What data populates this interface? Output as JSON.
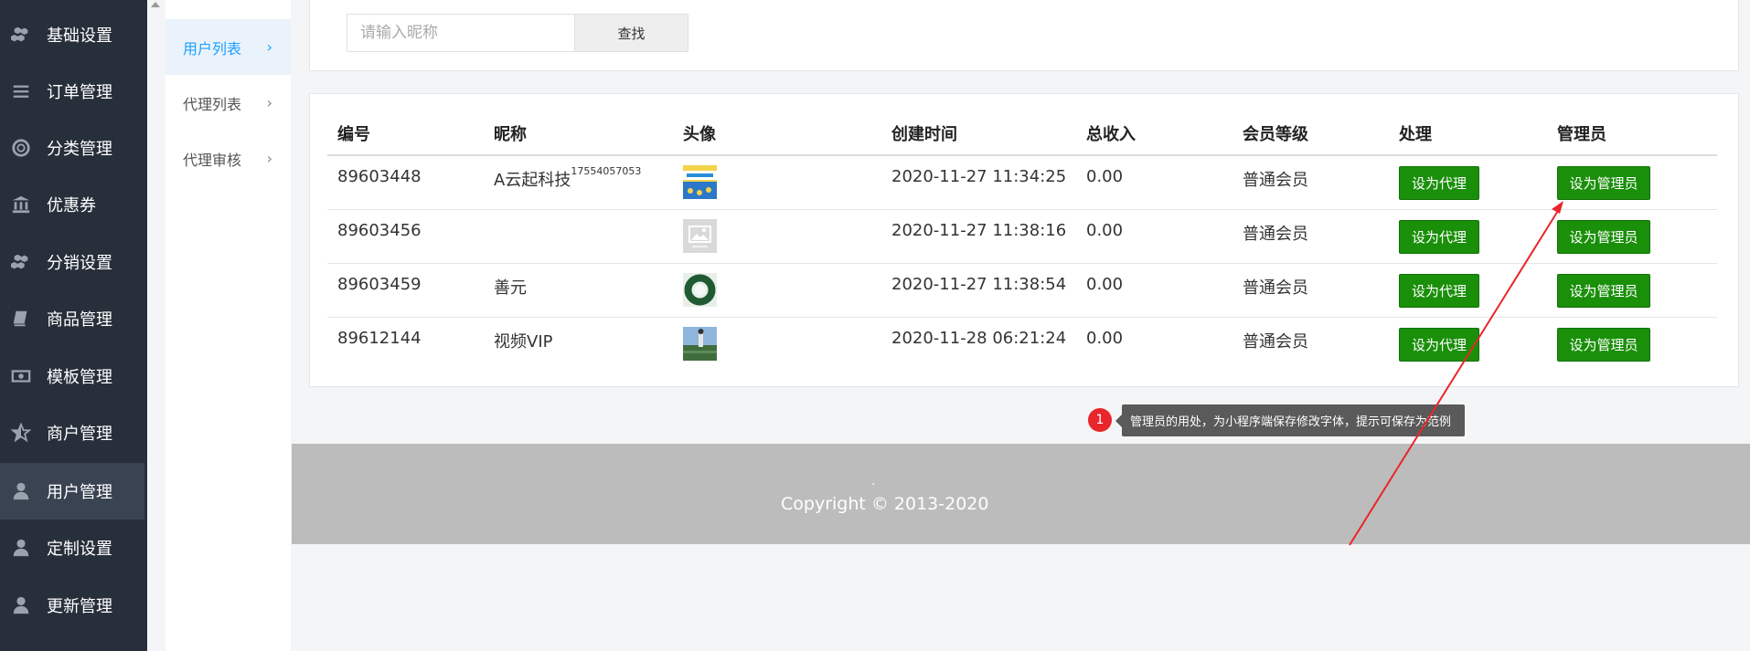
{
  "sidebar": {
    "items": [
      {
        "label": "基础设置",
        "icon": "cubes-icon"
      },
      {
        "label": "订单管理",
        "icon": "list-icon"
      },
      {
        "label": "分类管理",
        "icon": "lifebuoy-icon"
      },
      {
        "label": "优惠券",
        "icon": "bank-icon"
      },
      {
        "label": "分销设置",
        "icon": "cubes-icon"
      },
      {
        "label": "商品管理",
        "icon": "book-icon"
      },
      {
        "label": "模板管理",
        "icon": "money-icon"
      },
      {
        "label": "商户管理",
        "icon": "star-half-icon"
      },
      {
        "label": "用户管理",
        "icon": "user-icon",
        "active": true
      },
      {
        "label": "定制设置",
        "icon": "user-icon"
      },
      {
        "label": "更新管理",
        "icon": "user-icon"
      }
    ]
  },
  "submenu": {
    "items": [
      {
        "label": "用户列表",
        "active": true
      },
      {
        "label": "代理列表"
      },
      {
        "label": "代理审核"
      }
    ]
  },
  "search": {
    "placeholder": "请输入昵称",
    "button_label": "查找"
  },
  "table": {
    "headers": [
      "编号",
      "昵称",
      "头像",
      "创建时间",
      "总收入",
      "会员等级",
      "处理",
      "管理员"
    ],
    "rows": [
      {
        "id": "89603448",
        "nickname": "A云起科技",
        "nickname_sup": "17554057053",
        "avatar": "book-cover",
        "created": "2020-11-27 11:34:25",
        "income": "0.00",
        "level": "普通会员",
        "action": "设为代理",
        "admin": "设为管理员"
      },
      {
        "id": "89603456",
        "nickname": "",
        "nickname_sup": "",
        "avatar": "placeholder-image",
        "created": "2020-11-27 11:38:16",
        "income": "0.00",
        "level": "普通会员",
        "action": "设为代理",
        "admin": "设为管理员"
      },
      {
        "id": "89603459",
        "nickname": "善元",
        "nickname_sup": "",
        "avatar": "green-wreath",
        "created": "2020-11-27 11:38:54",
        "income": "0.00",
        "level": "普通会员",
        "action": "设为代理",
        "admin": "设为管理员"
      },
      {
        "id": "89612144",
        "nickname": "视频VIP",
        "nickname_sup": "",
        "avatar": "landscape-photo",
        "created": "2020-11-28 06:21:24",
        "income": "0.00",
        "level": "普通会员",
        "action": "设为代理",
        "admin": "设为管理员"
      }
    ]
  },
  "annotation": {
    "number": "1",
    "text": "管理员的用处，为小程序端保存修改字体，提示可保存为范例"
  },
  "footer": {
    "dot": ".",
    "copyright": "Copyright © 2013-2020"
  },
  "colors": {
    "sidebar_bg": "#272f3a",
    "accent_blue": "#1e9fff",
    "button_green": "#1a8f0a",
    "badge_red": "#e8262b"
  }
}
